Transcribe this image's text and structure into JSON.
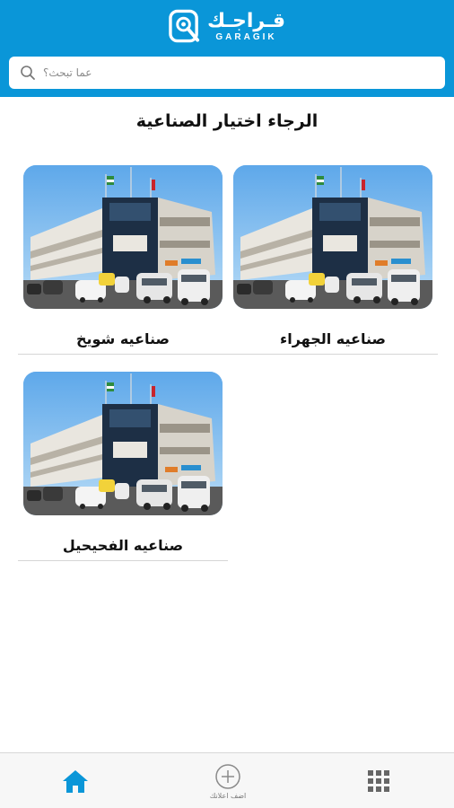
{
  "header": {
    "logo_ar": "قـراجـك",
    "logo_en": "GARAGIK",
    "brand_color": "#0a96d8"
  },
  "search": {
    "placeholder": "عما تبحث؟",
    "icon": "search-icon"
  },
  "page_title": "الرجاء اختيار الصناعية",
  "areas": [
    {
      "label": "صناعيه الجهراء",
      "image": "industrial-building-photo"
    },
    {
      "label": "صناعيه شويخ",
      "image": "industrial-building-photo"
    },
    {
      "label": "صناعيه الفحيحيل",
      "image": "industrial-building-photo"
    }
  ],
  "bottom_nav": {
    "home_icon": "home-icon",
    "add_label": "اضف اعلانك",
    "add_icon": "plus-circle-icon",
    "menu_icon": "grid-menu-icon",
    "active_color": "#0a96d8"
  }
}
